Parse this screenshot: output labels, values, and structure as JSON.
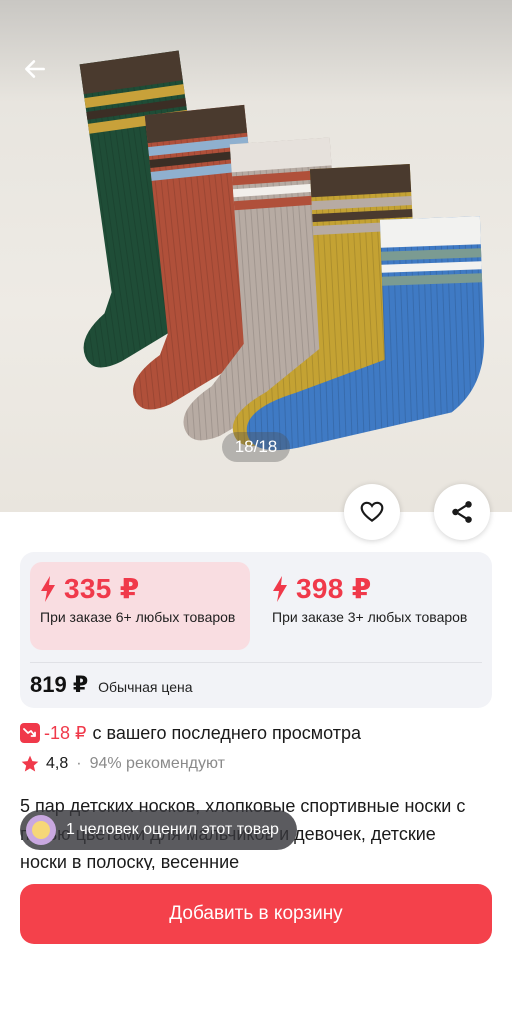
{
  "gallery": {
    "counter": "18/18"
  },
  "price_tiers": [
    {
      "price": "335 ₽",
      "condition": "При заказе 6+ любых товаров"
    },
    {
      "price": "398 ₽",
      "condition": "При заказе 3+ любых товаров"
    }
  ],
  "regular_price": {
    "amount": "819 ₽",
    "label": "Обычная цена"
  },
  "price_drop": {
    "amount": "-18 ₽",
    "text": "с вашего последнего просмотра"
  },
  "rating": {
    "value": "4,8",
    "separator": "·",
    "recommend": "94% рекомендуют"
  },
  "product_title": "5 пар детских носков, хлопковые спортивные носки с пятью цветами для мальчиков и девочек, детские носки в полоску, весенние",
  "toast": {
    "message": "1 человек оценил этот товар"
  },
  "cart_button": {
    "label": "Добавить в корзину"
  },
  "colors": {
    "accent": "#f0394a",
    "button": "#f4414b",
    "tier_highlight": "#f9dde1",
    "card_bg": "#f2f3f7"
  },
  "icons": [
    "arrow-left-icon",
    "heart-icon",
    "share-icon",
    "lightning-icon",
    "price-down-icon",
    "star-icon"
  ]
}
